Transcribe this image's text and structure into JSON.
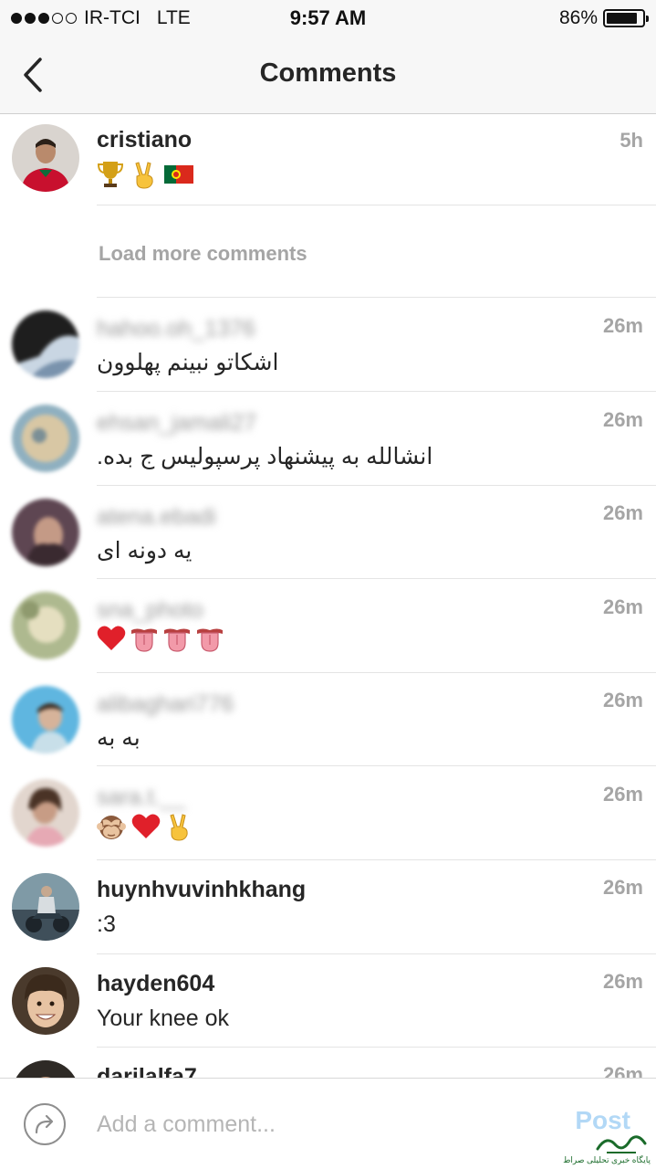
{
  "status_bar": {
    "carrier": "IR-TCI",
    "network": "LTE",
    "time": "9:57 AM",
    "battery_percent": "86%",
    "battery_level": 0.86,
    "signal_bars_filled": 3,
    "signal_bars_total": 5
  },
  "nav": {
    "title": "Comments",
    "back_icon": "chevron-left-icon"
  },
  "caption": {
    "username": "cristiano",
    "time": "5h",
    "emojis": [
      "trophy",
      "victory-hand",
      "portugal-flag"
    ]
  },
  "load_more_label": "Load more comments",
  "comments": [
    {
      "username": "hahoo.oh_1376",
      "text": "اشکاتو نبینم پهلوون",
      "time": "26m",
      "blurred": true
    },
    {
      "username": "ehsan_jamali27",
      "text": "انشالله به پیشنهاد پرسپولیس ج بده.",
      "time": "26m",
      "blurred": true
    },
    {
      "username": "atena.ebadi",
      "text": "یه دونه ای",
      "time": "26m",
      "blurred": true
    },
    {
      "username": "sna_photo",
      "text": "",
      "emojis": [
        "heart",
        "tongue",
        "tongue",
        "tongue"
      ],
      "time": "26m",
      "blurred": true
    },
    {
      "username": "alibaghari776",
      "text": "به به",
      "time": "26m",
      "blurred": true
    },
    {
      "username": "sara.t.__",
      "text": "",
      "emojis": [
        "see-no-evil-monkey",
        "heart",
        "victory-hand"
      ],
      "time": "26m",
      "blurred": true
    },
    {
      "username": "huynhvuvinhkhang",
      "text": ":3",
      "time": "26m",
      "blurred": false
    },
    {
      "username": "hayden604",
      "text": "Your knee ok",
      "time": "26m",
      "blurred": false
    },
    {
      "username": "darilalfa7",
      "text": "",
      "time": "26m",
      "blurred": false
    }
  ],
  "input": {
    "placeholder": "Add a comment...",
    "post_label": "Post"
  },
  "watermark_text": "پایگاه خبری تحلیلی صراط",
  "colors": {
    "accent_disabled": "#b2d8f6",
    "secondary_text": "#a5a5a5",
    "heart": "#e0202a"
  }
}
